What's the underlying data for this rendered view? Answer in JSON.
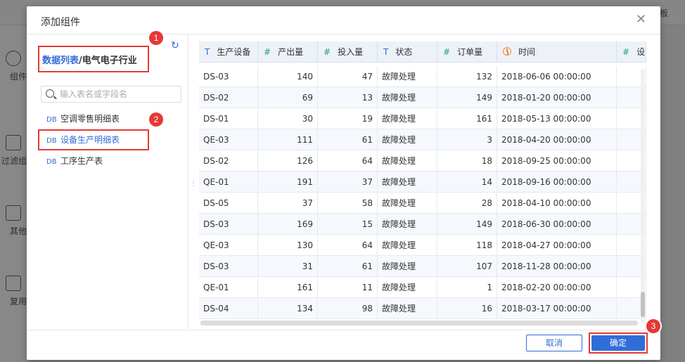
{
  "background": {
    "top_right_label": "板",
    "sidebar_items": [
      {
        "label": "组件",
        "icon": "plus-circle-icon"
      },
      {
        "label": "过滤组",
        "icon": "cube-icon"
      },
      {
        "label": "其他",
        "icon": "document-icon"
      },
      {
        "label": "复用",
        "icon": "copy-icon"
      }
    ]
  },
  "dialog": {
    "title": "添加组件",
    "close_icon": "close-icon",
    "breadcrumb": {
      "root": "数据列表",
      "separator": "/",
      "current": "电气电子行业"
    },
    "refresh_icon": "refresh-icon",
    "search": {
      "placeholder": "输入表名或字段名",
      "value": ""
    },
    "tables": [
      {
        "prefix": "DB",
        "label": "空调零售明细表"
      },
      {
        "prefix": "DB",
        "label": "设备生产明细表"
      },
      {
        "prefix": "DB",
        "label": "工序生产表"
      }
    ],
    "columns": [
      {
        "type": "T",
        "label": "生产设备"
      },
      {
        "type": "#",
        "label": "产出量"
      },
      {
        "type": "#",
        "label": "投入量"
      },
      {
        "type": "T",
        "label": "状态"
      },
      {
        "type": "#",
        "label": "订单量"
      },
      {
        "type": "date",
        "label": "时间"
      },
      {
        "type": "#",
        "label": "设"
      }
    ],
    "rows": [
      [
        "DS-03",
        "140",
        "47",
        "故障处理",
        "132",
        "2018-06-06 00:00:00"
      ],
      [
        "DS-02",
        "69",
        "13",
        "故障处理",
        "149",
        "2018-01-20 00:00:00"
      ],
      [
        "DS-01",
        "30",
        "19",
        "故障处理",
        "161",
        "2018-05-13 00:00:00"
      ],
      [
        "QE-03",
        "111",
        "61",
        "故障处理",
        "3",
        "2018-04-20 00:00:00"
      ],
      [
        "DS-02",
        "126",
        "64",
        "故障处理",
        "18",
        "2018-09-25 00:00:00"
      ],
      [
        "QE-01",
        "191",
        "37",
        "故障处理",
        "14",
        "2018-09-16 00:00:00"
      ],
      [
        "DS-05",
        "37",
        "58",
        "故障处理",
        "28",
        "2018-04-10 00:00:00"
      ],
      [
        "DS-03",
        "169",
        "15",
        "故障处理",
        "149",
        "2018-06-30 00:00:00"
      ],
      [
        "QE-03",
        "130",
        "64",
        "故障处理",
        "118",
        "2018-04-27 00:00:00"
      ],
      [
        "DS-03",
        "31",
        "61",
        "故障处理",
        "107",
        "2018-11-28 00:00:00"
      ],
      [
        "QE-01",
        "161",
        "11",
        "故障处理",
        "1",
        "2018-02-20 00:00:00"
      ],
      [
        "DS-04",
        "134",
        "98",
        "故障处理",
        "16",
        "2018-03-17 00:00:00"
      ]
    ],
    "cancel_label": "取消",
    "ok_label": "确定"
  },
  "annotations": [
    "1",
    "2",
    "3"
  ],
  "colors": {
    "accent": "#2f6dd8",
    "highlight": "#e53935",
    "numeric_type": "#1ea47a",
    "date_type": "#f0883a"
  }
}
